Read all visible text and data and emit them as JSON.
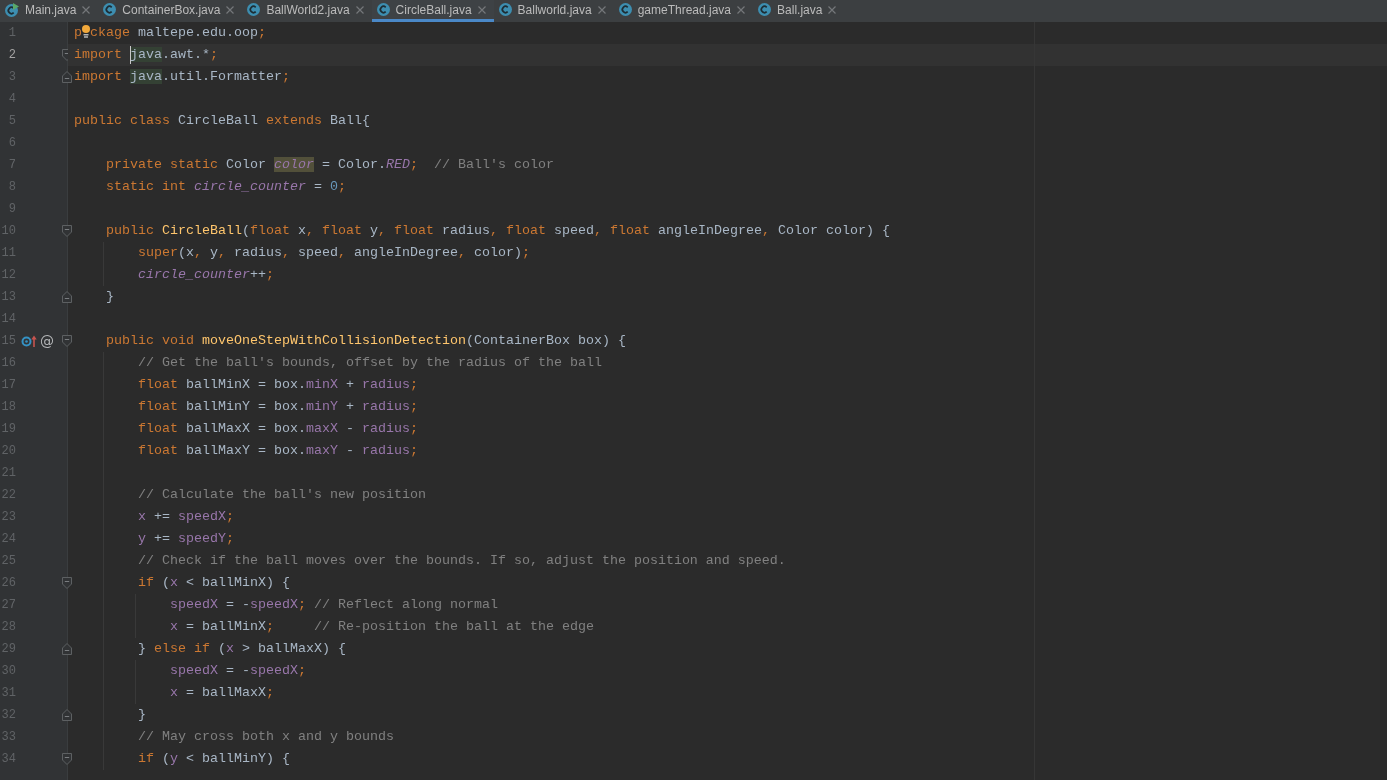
{
  "tabs": [
    {
      "label": "Main.java",
      "selected": false,
      "kind": "runnable"
    },
    {
      "label": "ContainerBox.java",
      "selected": false,
      "kind": "class"
    },
    {
      "label": "BallWorld2.java",
      "selected": false,
      "kind": "class"
    },
    {
      "label": "CircleBall.java",
      "selected": true,
      "kind": "class"
    },
    {
      "label": "Ballworld.java",
      "selected": false,
      "kind": "class"
    },
    {
      "label": "gameThread.java",
      "selected": false,
      "kind": "class"
    },
    {
      "label": "Ball.java",
      "selected": false,
      "kind": "class"
    }
  ],
  "lines": [
    {
      "number": "1",
      "current": false,
      "tokens": [
        {
          "text": "p",
          "kind": "keyword"
        },
        {
          "kind": "lightbulb"
        },
        {
          "text": "ckage",
          "kind": "keyword"
        },
        {
          "text": " maltepe.edu.oop",
          "kind": "plain"
        },
        {
          "text": ";",
          "kind": "punct"
        }
      ]
    },
    {
      "number": "2",
      "current": true,
      "gutter_icons": [
        {
          "kind": "fold_start"
        }
      ],
      "tokens": [
        {
          "text": "import ",
          "kind": "keyword"
        },
        {
          "kind": "caret"
        },
        {
          "text": "java",
          "kind": "reference"
        },
        {
          "text": ".awt.*",
          "kind": "plain"
        },
        {
          "text": ";",
          "kind": "punct"
        }
      ]
    },
    {
      "number": "3",
      "current": false,
      "gutter_icons": [
        {
          "kind": "fold_end"
        }
      ],
      "tokens": [
        {
          "text": "import ",
          "kind": "keyword"
        },
        {
          "text": "java",
          "kind": "reference"
        },
        {
          "text": ".util.Formatter",
          "kind": "plain"
        },
        {
          "text": ";",
          "kind": "punct"
        }
      ]
    },
    {
      "number": "4",
      "current": false
    },
    {
      "number": "5",
      "current": false,
      "tokens": [
        {
          "text": "public class ",
          "kind": "keyword"
        },
        {
          "text": "CircleBall ",
          "kind": "plain"
        },
        {
          "text": "extends",
          "kind": "keyword"
        },
        {
          "text": " Ball{",
          "kind": "plain"
        }
      ],
      "children": [
        {
          "number": "6",
          "current": false
        },
        {
          "number": "7",
          "current": false,
          "tokens": [
            {
              "text": "private static",
              "kind": "keyword"
            },
            {
              "text": " Color ",
              "kind": "plain"
            },
            {
              "text": "color",
              "kind": "usage"
            },
            {
              "text": " = Color.",
              "kind": "plain"
            },
            {
              "text": "RED",
              "kind": "static_field"
            },
            {
              "text": ";",
              "kind": "punct"
            },
            {
              "text": "  // Ball's color",
              "kind": "comment"
            }
          ]
        },
        {
          "number": "8",
          "current": false,
          "tokens": [
            {
              "text": "static int ",
              "kind": "keyword"
            },
            {
              "text": "circle_counter",
              "kind": "static_field"
            },
            {
              "text": " = ",
              "kind": "plain"
            },
            {
              "text": "0",
              "kind": "number"
            },
            {
              "text": ";",
              "kind": "punct"
            }
          ]
        },
        {
          "number": "9",
          "current": false
        },
        {
          "number": "10",
          "current": false,
          "gutter_icons": [
            {
              "kind": "fold_start"
            }
          ],
          "tokens": [
            {
              "text": "public ",
              "kind": "keyword"
            },
            {
              "text": "CircleBall",
              "kind": "method_decl"
            },
            {
              "text": "(",
              "kind": "plain"
            },
            {
              "text": "float",
              "kind": "keyword"
            },
            {
              "text": " x",
              "kind": "plain"
            },
            {
              "text": ",",
              "kind": "punct"
            },
            {
              "text": " float",
              "kind": "keyword"
            },
            {
              "text": " y",
              "kind": "plain"
            },
            {
              "text": ",",
              "kind": "punct"
            },
            {
              "text": " float",
              "kind": "keyword"
            },
            {
              "text": " radius",
              "kind": "plain"
            },
            {
              "text": ",",
              "kind": "punct"
            },
            {
              "text": " float",
              "kind": "keyword"
            },
            {
              "text": " speed",
              "kind": "plain"
            },
            {
              "text": ",",
              "kind": "punct"
            },
            {
              "text": " float",
              "kind": "keyword"
            },
            {
              "text": " angleInDegree",
              "kind": "plain"
            },
            {
              "text": ",",
              "kind": "punct"
            },
            {
              "text": " Color color) {",
              "kind": "plain"
            }
          ],
          "children": [
            {
              "number": "11",
              "current": false,
              "tokens": [
                {
                  "text": "super",
                  "kind": "keyword"
                },
                {
                  "text": "(x",
                  "kind": "plain"
                },
                {
                  "text": ",",
                  "kind": "punct"
                },
                {
                  "text": " y",
                  "kind": "plain"
                },
                {
                  "text": ",",
                  "kind": "punct"
                },
                {
                  "text": " radius",
                  "kind": "plain"
                },
                {
                  "text": ",",
                  "kind": "punct"
                },
                {
                  "text": " speed",
                  "kind": "plain"
                },
                {
                  "text": ",",
                  "kind": "punct"
                },
                {
                  "text": " angleInDegree",
                  "kind": "plain"
                },
                {
                  "text": ",",
                  "kind": "punct"
                },
                {
                  "text": " color)",
                  "kind": "plain"
                },
                {
                  "text": ";",
                  "kind": "punct"
                }
              ]
            },
            {
              "number": "12",
              "current": false,
              "tokens": [
                {
                  "text": "circle_counter",
                  "kind": "static_field"
                },
                {
                  "text": "++",
                  "kind": "plain"
                },
                {
                  "text": ";",
                  "kind": "punct"
                }
              ]
            }
          ]
        },
        {
          "number": "13",
          "current": false,
          "gutter_icons": [
            {
              "kind": "fold_end"
            }
          ],
          "tokens": [
            {
              "text": "}",
              "kind": "plain"
            }
          ]
        },
        {
          "number": "14",
          "current": false
        },
        {
          "number": "15",
          "current": false,
          "gutter_icons": [
            {
              "kind": "overrides"
            },
            {
              "kind": "glyph",
              "text": "@"
            },
            {
              "kind": "fold_start"
            }
          ],
          "tokens": [
            {
              "text": "public void ",
              "kind": "keyword"
            },
            {
              "text": "moveOneStepWithCollisionDetection",
              "kind": "method_decl"
            },
            {
              "text": "(ContainerBox box) {",
              "kind": "plain"
            }
          ],
          "children": [
            {
              "number": "16",
              "current": false,
              "tokens": [
                {
                  "text": "// Get the ball's bounds, offset by the radius of the ball",
                  "kind": "comment"
                }
              ]
            },
            {
              "number": "17",
              "current": false,
              "tokens": [
                {
                  "text": "float",
                  "kind": "keyword"
                },
                {
                  "text": " ballMinX = box.",
                  "kind": "plain"
                },
                {
                  "text": "minX",
                  "kind": "field"
                },
                {
                  "text": " + ",
                  "kind": "plain"
                },
                {
                  "text": "radius",
                  "kind": "field"
                },
                {
                  "text": ";",
                  "kind": "punct"
                }
              ]
            },
            {
              "number": "18",
              "current": false,
              "tokens": [
                {
                  "text": "float",
                  "kind": "keyword"
                },
                {
                  "text": " ballMinY = box.",
                  "kind": "plain"
                },
                {
                  "text": "minY",
                  "kind": "field"
                },
                {
                  "text": " + ",
                  "kind": "plain"
                },
                {
                  "text": "radius",
                  "kind": "field"
                },
                {
                  "text": ";",
                  "kind": "punct"
                }
              ]
            },
            {
              "number": "19",
              "current": false,
              "tokens": [
                {
                  "text": "float",
                  "kind": "keyword"
                },
                {
                  "text": " ballMaxX = box.",
                  "kind": "plain"
                },
                {
                  "text": "maxX",
                  "kind": "field"
                },
                {
                  "text": " - ",
                  "kind": "plain"
                },
                {
                  "text": "radius",
                  "kind": "field"
                },
                {
                  "text": ";",
                  "kind": "punct"
                }
              ]
            },
            {
              "number": "20",
              "current": false,
              "tokens": [
                {
                  "text": "float",
                  "kind": "keyword"
                },
                {
                  "text": " ballMaxY = box.",
                  "kind": "plain"
                },
                {
                  "text": "maxY",
                  "kind": "field"
                },
                {
                  "text": " - ",
                  "kind": "plain"
                },
                {
                  "text": "radius",
                  "kind": "field"
                },
                {
                  "text": ";",
                  "kind": "punct"
                }
              ]
            },
            {
              "number": "21",
              "current": false
            },
            {
              "number": "22",
              "current": false,
              "tokens": [
                {
                  "text": "// Calculate the ball's new position",
                  "kind": "comment"
                }
              ]
            },
            {
              "number": "23",
              "current": false,
              "tokens": [
                {
                  "text": "x",
                  "kind": "field"
                },
                {
                  "text": " += ",
                  "kind": "plain"
                },
                {
                  "text": "speedX",
                  "kind": "field"
                },
                {
                  "text": ";",
                  "kind": "punct"
                }
              ]
            },
            {
              "number": "24",
              "current": false,
              "tokens": [
                {
                  "text": "y",
                  "kind": "field"
                },
                {
                  "text": " += ",
                  "kind": "plain"
                },
                {
                  "text": "speedY",
                  "kind": "field"
                },
                {
                  "text": ";",
                  "kind": "punct"
                }
              ]
            },
            {
              "number": "25",
              "current": false,
              "tokens": [
                {
                  "text": "// Check if the ball moves over the bounds. If so, adjust the position and speed.",
                  "kind": "comment"
                }
              ]
            },
            {
              "number": "26",
              "current": false,
              "gutter_icons": [
                {
                  "kind": "fold_start"
                }
              ],
              "tokens": [
                {
                  "text": "if",
                  "kind": "keyword"
                },
                {
                  "text": " (",
                  "kind": "plain"
                },
                {
                  "text": "x",
                  "kind": "field"
                },
                {
                  "text": " < ballMinX) {",
                  "kind": "plain"
                }
              ],
              "children": [
                {
                  "number": "27",
                  "current": false,
                  "tokens": [
                    {
                      "text": "speedX",
                      "kind": "field"
                    },
                    {
                      "text": " = -",
                      "kind": "plain"
                    },
                    {
                      "text": "speedX",
                      "kind": "field"
                    },
                    {
                      "text": ";",
                      "kind": "punct"
                    },
                    {
                      "text": " // Reflect along normal",
                      "kind": "comment"
                    }
                  ]
                },
                {
                  "number": "28",
                  "current": false,
                  "tokens": [
                    {
                      "text": "x",
                      "kind": "field"
                    },
                    {
                      "text": " = ballMinX",
                      "kind": "plain"
                    },
                    {
                      "text": ";",
                      "kind": "punct"
                    },
                    {
                      "text": "     // Re-position the ball at the edge",
                      "kind": "comment"
                    }
                  ]
                }
              ]
            },
            {
              "number": "29",
              "current": false,
              "gutter_icons": [
                {
                  "kind": "fold_end"
                }
              ],
              "tokens": [
                {
                  "text": "} ",
                  "kind": "plain"
                },
                {
                  "text": "else if",
                  "kind": "keyword"
                },
                {
                  "text": " (",
                  "kind": "plain"
                },
                {
                  "text": "x",
                  "kind": "field"
                },
                {
                  "text": " > ballMaxX) {",
                  "kind": "plain"
                }
              ],
              "children": [
                {
                  "number": "30",
                  "current": false,
                  "tokens": [
                    {
                      "text": "speedX",
                      "kind": "field"
                    },
                    {
                      "text": " = -",
                      "kind": "plain"
                    },
                    {
                      "text": "speedX",
                      "kind": "field"
                    },
                    {
                      "text": ";",
                      "kind": "punct"
                    }
                  ]
                },
                {
                  "number": "31",
                  "current": false,
                  "tokens": [
                    {
                      "text": "x",
                      "kind": "field"
                    },
                    {
                      "text": " = ballMaxX",
                      "kind": "plain"
                    },
                    {
                      "text": ";",
                      "kind": "punct"
                    }
                  ]
                }
              ]
            },
            {
              "number": "32",
              "current": false,
              "gutter_icons": [
                {
                  "kind": "fold_end"
                }
              ],
              "tokens": [
                {
                  "text": "}",
                  "kind": "plain"
                }
              ]
            },
            {
              "number": "33",
              "current": false,
              "tokens": [
                {
                  "text": "// May cross both x and y bounds",
                  "kind": "comment"
                }
              ]
            },
            {
              "number": "34",
              "current": false,
              "gutter_icons": [
                {
                  "kind": "fold_start"
                }
              ],
              "tokens": [
                {
                  "text": "if",
                  "kind": "keyword"
                },
                {
                  "text": " (",
                  "kind": "plain"
                },
                {
                  "text": "y",
                  "kind": "field"
                },
                {
                  "text": " < ballMinY) {",
                  "kind": "plain"
                }
              ]
            }
          ]
        }
      ]
    }
  ]
}
